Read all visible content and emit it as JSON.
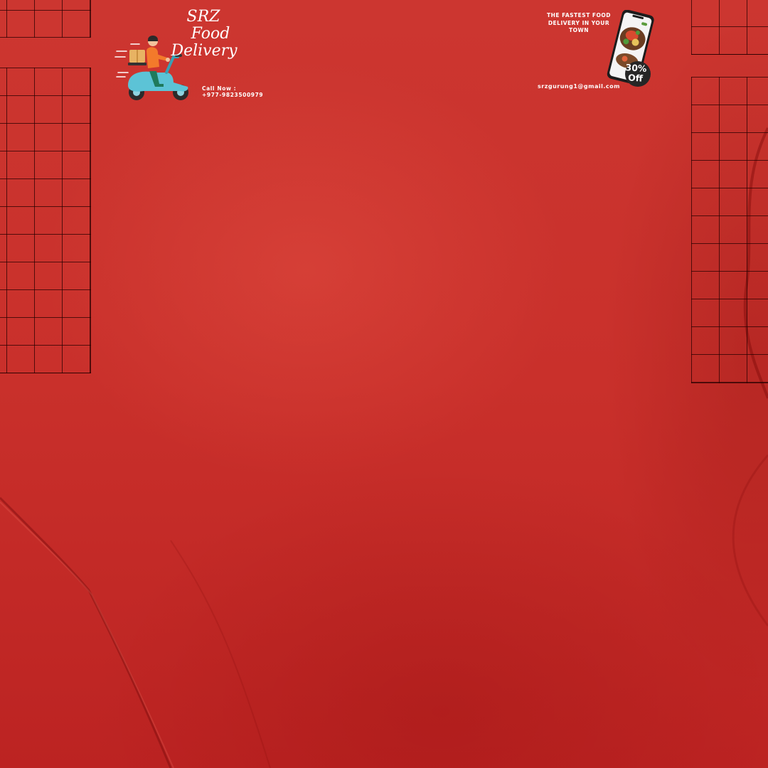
{
  "brand": {
    "name_line1": "SRZ",
    "name_line2": "Food",
    "name_line3": "Delivery"
  },
  "contact": {
    "call_label": "Call Now :",
    "phone": "+977-9823500979",
    "email": "srzgurung1@gmail.com"
  },
  "tagline": {
    "line1": "THE FASTEST FOOD",
    "line2": "DELIVERY IN YOUR",
    "line3": "TOWN"
  },
  "offer": {
    "percent": "30%",
    "word": "Off"
  },
  "colors": {
    "background": "#cc2f2a",
    "grid_lines": "#3a0606",
    "text": "#ffffff"
  },
  "icons": [
    "delivery-scooter-icon",
    "phone-food-app-icon"
  ]
}
